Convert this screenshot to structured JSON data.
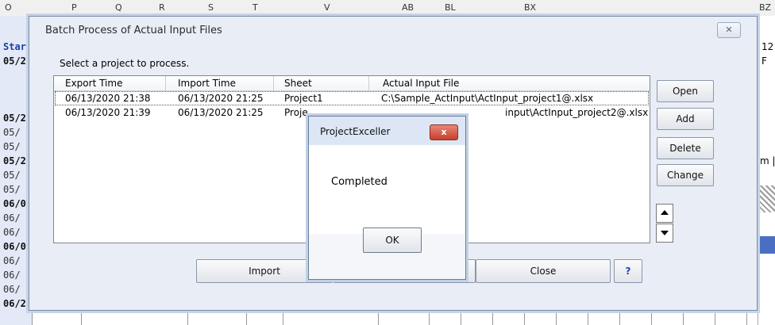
{
  "spreadsheet": {
    "column_letters": [
      "O",
      "P",
      "Q",
      "R",
      "S",
      "T",
      "V",
      "AB",
      "BL",
      "BX",
      "BZ"
    ],
    "right_cells": [
      "12",
      "F",
      "m |"
    ],
    "left_rows": [
      {
        "text": "Star",
        "weight": "bold"
      },
      {
        "text": "05/2",
        "weight": "bold"
      },
      {
        "text": "05/2",
        "weight": "bold"
      },
      {
        "text": "05/",
        "weight": "light"
      },
      {
        "text": "05/",
        "weight": "light"
      },
      {
        "text": "05/2",
        "weight": "bold"
      },
      {
        "text": "05/",
        "weight": "light"
      },
      {
        "text": "05/",
        "weight": "light"
      },
      {
        "text": "06/0",
        "weight": "bold"
      },
      {
        "text": "06/",
        "weight": "light"
      },
      {
        "text": "06/",
        "weight": "light"
      },
      {
        "text": "06/0",
        "weight": "bold"
      },
      {
        "text": "06/",
        "weight": "light"
      },
      {
        "text": "06/",
        "weight": "light"
      },
      {
        "text": "06/",
        "weight": "light"
      },
      {
        "text": "06/2",
        "weight": "bold"
      }
    ]
  },
  "dialog": {
    "title": "Batch Process of Actual Input Files",
    "prompt": "Select a project to process.",
    "columns": [
      "Export Time",
      "Import Time",
      "Sheet",
      "Actual Input File"
    ],
    "rows": [
      {
        "export": "06/13/2020 21:38",
        "import": "06/13/2020 21:25",
        "sheet": "Project1",
        "file": "C:\\Sample_ActInput\\ActInput_project1@.xlsx"
      },
      {
        "export": "06/13/2020 21:39",
        "import": "06/13/2020 21:25",
        "sheet": "Proje",
        "file": "input\\ActInput_project2@.xlsx"
      }
    ],
    "buttons": {
      "open": "Open",
      "add": "Add",
      "delete": "Delete",
      "change": "Change",
      "import": "Import",
      "close": "Close",
      "help": "?"
    }
  },
  "popup": {
    "title": "ProjectExceller",
    "close_glyph": "x",
    "message": "Completed",
    "ok": "OK"
  }
}
